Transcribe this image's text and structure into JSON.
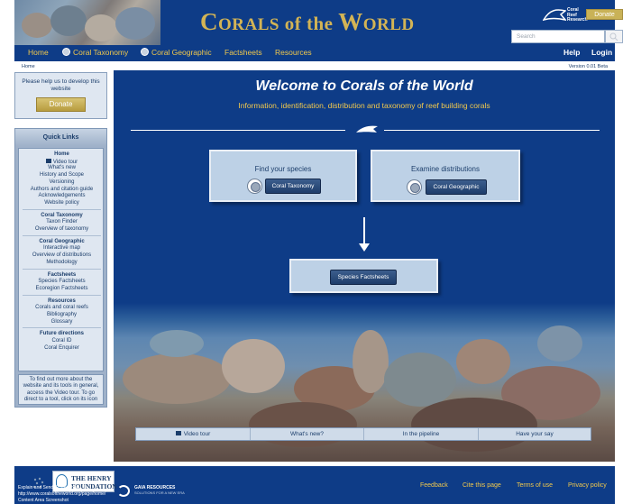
{
  "header": {
    "site_title_big1": "C",
    "site_title_small1": "ORALS",
    "site_title_mid": " of the ",
    "site_title_big2": "W",
    "site_title_small2": "ORLD",
    "partner_logo_text": [
      "Coral",
      "Reef",
      "Research"
    ],
    "donate_label": "Donate",
    "search_placeholder": "Search"
  },
  "nav": {
    "items": [
      "Home",
      "Coral Taxonomy",
      "Coral Geographic",
      "Factsheets",
      "Resources"
    ],
    "help": "Help",
    "login": "Login"
  },
  "subbar": {
    "breadcrumb": "Home",
    "version": "Version 0.01 Beta"
  },
  "sidebar": {
    "donate_text": "Please help us to develop this website",
    "donate_button": "Donate",
    "quick_links_title": "Quick Links",
    "groups": [
      {
        "title": "Home",
        "links": [
          "Video tour",
          "What's new",
          "History and Scope",
          "Versioning",
          "Authors and citation guide",
          "Acknowledgements",
          "Website policy"
        ]
      },
      {
        "title": "Coral Taxonomy",
        "links": [
          "Taxon Finder",
          "Overview of taxonomy"
        ]
      },
      {
        "title": "Coral Geographic",
        "links": [
          "Interactive map",
          "Overview of distributions",
          "Methodology"
        ]
      },
      {
        "title": "Factsheets",
        "links": [
          "Species Factsheets",
          "Ecoregion Factsheets"
        ]
      },
      {
        "title": "Resources",
        "links": [
          "Corals and coral reefs",
          "Bibliography",
          "Glossary"
        ]
      },
      {
        "title": "Future directions",
        "links": [
          "Coral ID",
          "Coral Enquirer"
        ]
      }
    ],
    "footer_text": "To find out more about the website and its tools in general, access the Video tour. To go direct to a tool, click on its icon"
  },
  "main": {
    "welcome": "Welcome to Corals of the World",
    "tagline": "Information, identification, distribution and taxonomy of reef building corals",
    "find_species_title": "Find your species",
    "find_species_button": "Coral Taxonomy",
    "distributions_title": "Examine distributions",
    "distributions_button": "Coral Geographic",
    "factsheets_button": "Species Factsheets",
    "features": [
      "Video tour",
      "What's new?",
      "In the pipeline",
      "Have your say"
    ]
  },
  "footer": {
    "sponsor_line1": "THE HENRY",
    "sponsor_line2": "FOUNDATION",
    "gaia_line1": "GAIA RESOURCES",
    "gaia_line2": "SOLUTIONS FOR A NEW ERA",
    "links": [
      "Feedback",
      "Cite this page",
      "Terms of use",
      "Privacy policy"
    ],
    "overlay_line1": "Explain and Send Screenshots",
    "overlay_line2": "http://www.coralsoftheworld.org/page/home/",
    "overlay_line3": "Content Area Screenshot"
  },
  "colors": {
    "brand_blue": "#0e3c87",
    "gold": "#d3b455",
    "nav_gold": "#f2c94c",
    "panel": "#bdd1e6"
  }
}
